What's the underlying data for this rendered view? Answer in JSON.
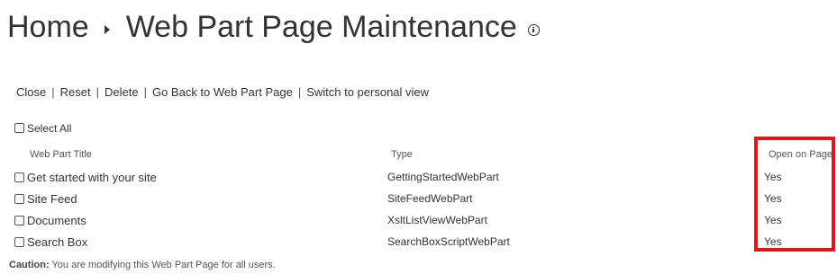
{
  "breadcrumb": {
    "home": "Home",
    "current": "Web Part Page Maintenance"
  },
  "toolbar": {
    "close": "Close",
    "reset": "Reset",
    "delete": "Delete",
    "go_back": "Go Back to Web Part Page",
    "switch": "Switch to personal view",
    "separator": "|"
  },
  "select_all": {
    "label": "Select All",
    "checked": false
  },
  "table": {
    "headers": {
      "title": "Web Part Title",
      "type": "Type",
      "open": "Open on Page"
    },
    "rows": [
      {
        "title": "Get started with your site",
        "type": "GettingStartedWebPart",
        "open": "Yes",
        "checked": false
      },
      {
        "title": "Site Feed",
        "type": "SiteFeedWebPart",
        "open": "Yes",
        "checked": false
      },
      {
        "title": "Documents",
        "type": "XsltListViewWebPart",
        "open": "Yes",
        "checked": false
      },
      {
        "title": "Search Box",
        "type": "SearchBoxScriptWebPart",
        "open": "Yes",
        "checked": false
      }
    ]
  },
  "caution": {
    "label": "Caution:",
    "text": "You are modifying this Web Part Page for all users."
  },
  "colors": {
    "highlight": "#e0161b",
    "text": "#333333"
  },
  "icons": {
    "breadcrumb_separator": "caret-right-icon",
    "info": "info-icon"
  }
}
